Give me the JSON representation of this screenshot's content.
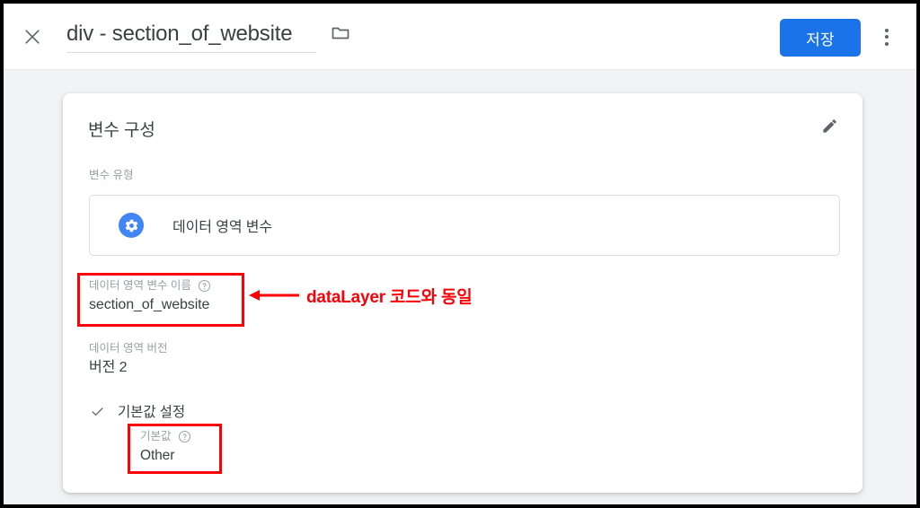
{
  "appbar": {
    "close_icon": "close-icon",
    "title": "div - section_of_website",
    "folder_icon": "folder-icon",
    "save_label": "저장",
    "kebab_icon": "more-vert-icon",
    "accent_color": "#1a73e8"
  },
  "card": {
    "title": "변수 구성",
    "edit_icon": "pencil-icon",
    "variable_type": {
      "label": "변수 유형",
      "icon": "gear-icon",
      "icon_color": "#4285f4",
      "value": "데이터 영역 변수"
    },
    "data_layer_variable_name": {
      "label": "데이터 영역 변수 이름",
      "help_icon": "help-circle-icon",
      "value": "section_of_website"
    },
    "data_layer_version": {
      "label": "데이터 영역 버전",
      "value": "버전 2"
    },
    "set_default_value": {
      "check_icon": "check-icon",
      "label": "기본값 설정",
      "default_value_label": "기본값",
      "help_icon": "help-circle-icon",
      "default_value": "Other"
    }
  },
  "annotations": {
    "color": "#fb0007",
    "arrow_icon": "arrow-left-icon",
    "note_text": "dataLayer 코드와 동일",
    "highlight_name_box": "데이터 영역 변수 이름",
    "highlight_default_box": "기본값"
  }
}
